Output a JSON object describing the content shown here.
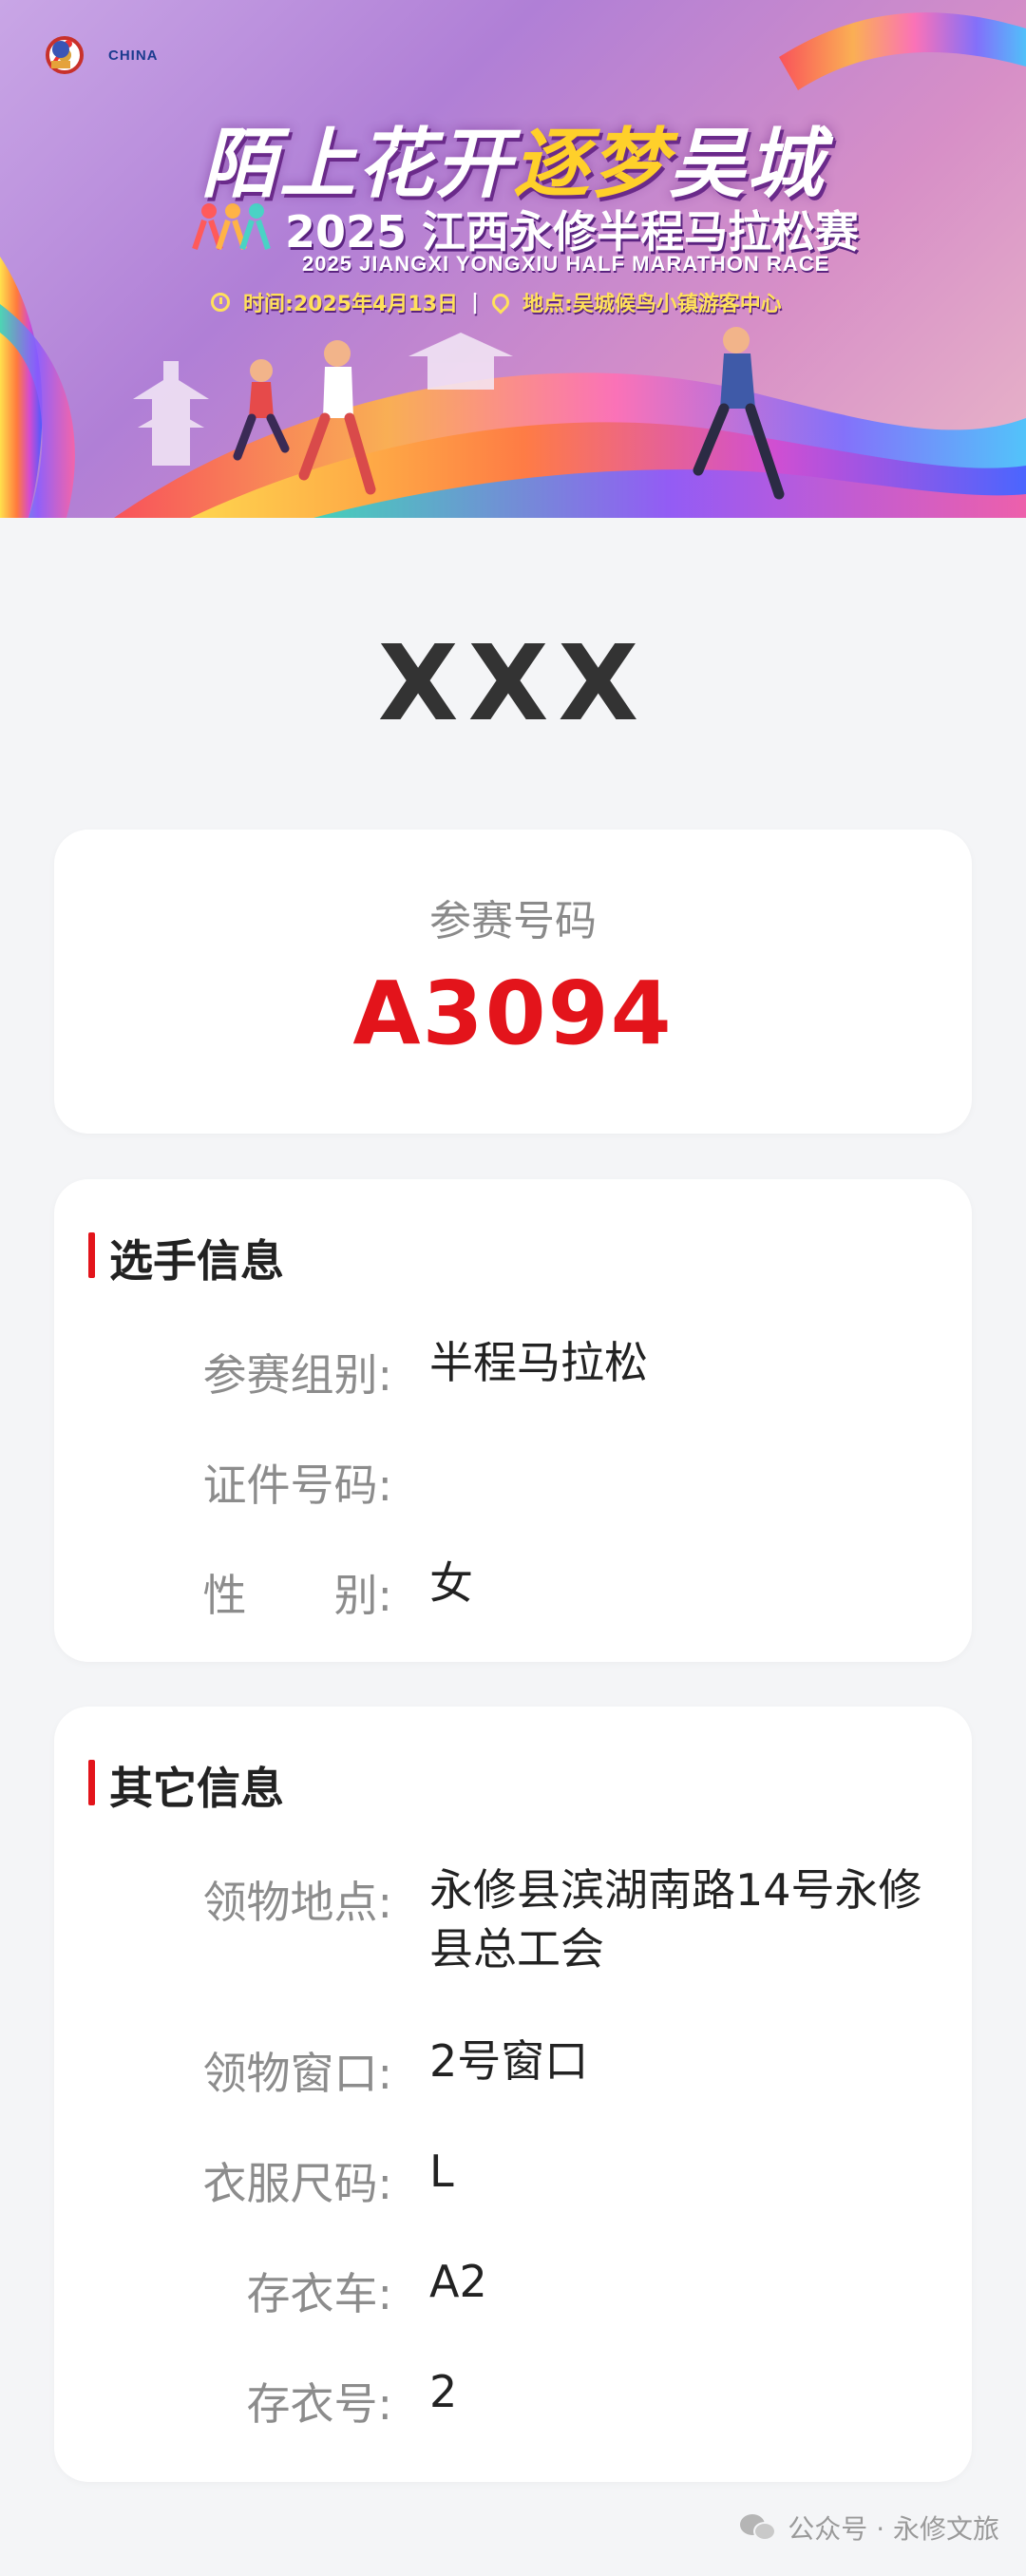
{
  "banner": {
    "logo_text": "CHINA",
    "title_part1": "陌上花开",
    "title_highlight": "逐梦",
    "title_part2": "吴城",
    "subtitle": "2025 江西永修半程马拉松赛",
    "subtitle_en": "2025 JIANGXI YONGXIU HALF MARATHON RACE",
    "time": "时间:2025年4月13日",
    "separator": "|",
    "location": "地点:吴城候鸟小镇游客中心"
  },
  "runner": {
    "name": "XXX"
  },
  "bib": {
    "label": "参赛号码",
    "number": "A3094"
  },
  "player_info": {
    "title": "选手信息",
    "rows": [
      {
        "label": "参赛组别:",
        "value": "半程马拉松"
      },
      {
        "label": "证件号码:",
        "value": ""
      },
      {
        "label": "性　　别:",
        "value": "女"
      }
    ]
  },
  "other_info": {
    "title": "其它信息",
    "rows": [
      {
        "label": "领物地点:",
        "value": "永修县滨湖南路14号永修县总工会"
      },
      {
        "label": "领物窗口:",
        "value": "2号窗口"
      },
      {
        "label": "衣服尺码:",
        "value": "L"
      },
      {
        "label": "存衣车:",
        "value": "A2"
      },
      {
        "label": "存衣号:",
        "value": "2"
      }
    ]
  },
  "footer": {
    "watermark": "公众号 · 永修文旅"
  },
  "colors": {
    "accent": "#e3141b",
    "background": "#f4f5f7"
  }
}
